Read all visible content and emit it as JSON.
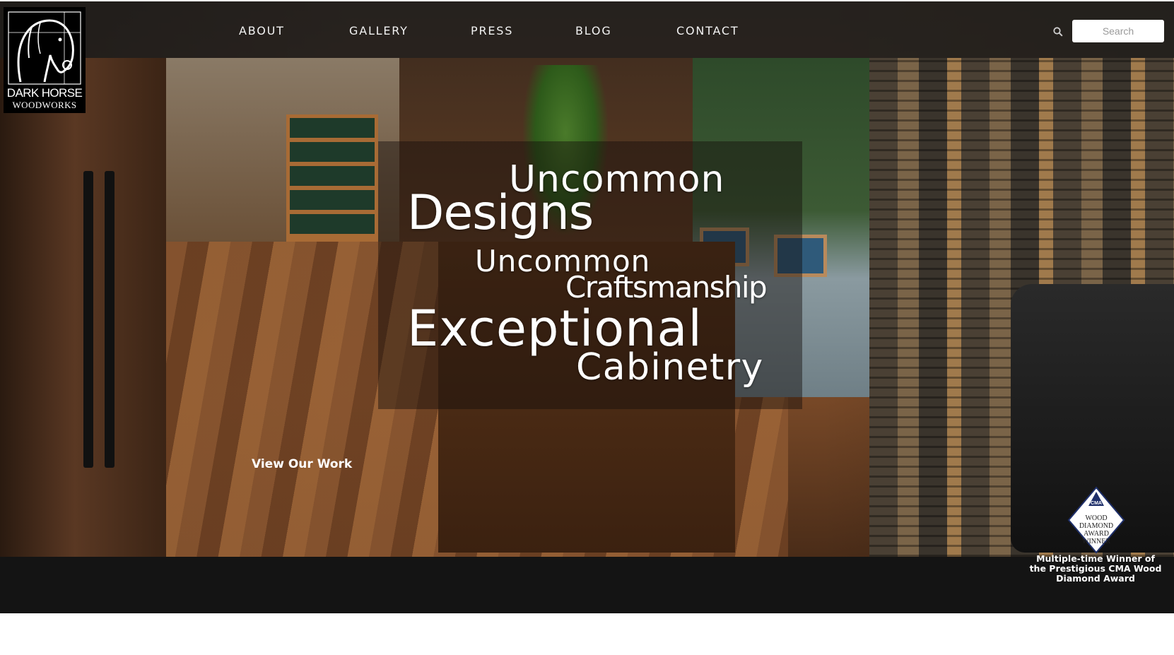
{
  "brand": {
    "line1": "DARK HORSE",
    "line2": "WOODWORKS"
  },
  "nav": {
    "items": [
      {
        "label": "ABOUT"
      },
      {
        "label": "GALLERY"
      },
      {
        "label": "PRESS"
      },
      {
        "label": "BLOG"
      },
      {
        "label": "CONTACT"
      }
    ]
  },
  "search": {
    "placeholder": "Search",
    "icon": "search-icon"
  },
  "tagline": {
    "w1": "Uncommon",
    "w2": "Designs",
    "w3": "Uncommon",
    "w4": "Craftsmanship",
    "w5": "Exceptional",
    "w6": "Cabinetry"
  },
  "cta": {
    "label": "View Our Work"
  },
  "award": {
    "badge_top": "CMA",
    "badge_lines": [
      "WOOD",
      "DIAMOND",
      "AWARD",
      "WINNER"
    ],
    "caption": "Multiple-time Winner of the Prestigious CMA Wood Diamond Award"
  },
  "colors": {
    "nav_bg": "#1e1e1e",
    "footer_bg": "#141414",
    "text": "#ffffff"
  }
}
